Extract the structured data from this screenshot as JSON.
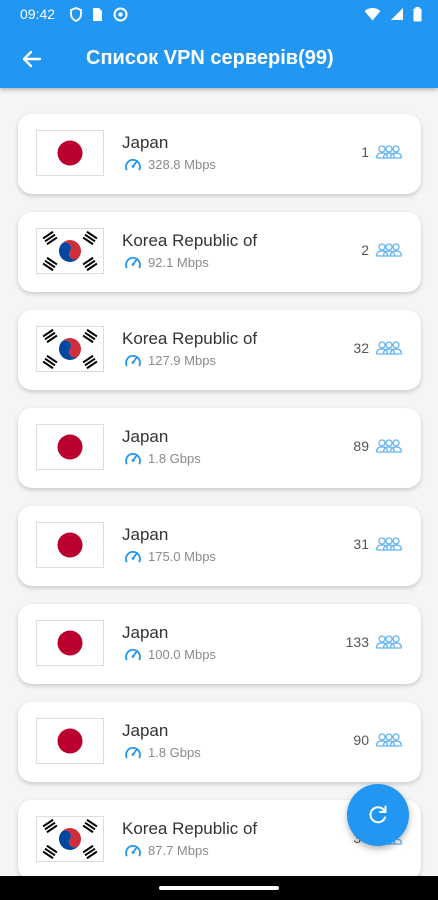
{
  "status_bar": {
    "time": "09:42",
    "left_icons": [
      "shield-icon",
      "sim-card-icon",
      "vpn-app-icon"
    ],
    "right_icons": [
      "wifi-icon",
      "signal-icon",
      "battery-icon"
    ]
  },
  "app_bar": {
    "back_icon": "arrow-back-icon",
    "title": "Список VPN серверів(99)"
  },
  "colors": {
    "primary": "#2196f3",
    "speed_icon": "#2196f3",
    "users_icon": "#64b5f6",
    "flag_japan_red": "#bc002d",
    "flag_korea_red": "#cd2e3a",
    "flag_korea_blue": "#0047a0"
  },
  "servers": [
    {
      "flag": "japan",
      "country": "Japan",
      "speed": "328.8 Mbps",
      "users": "1"
    },
    {
      "flag": "korea",
      "country": "Korea Republic of",
      "speed": "92.1 Mbps",
      "users": "2"
    },
    {
      "flag": "korea",
      "country": "Korea Republic of",
      "speed": "127.9 Mbps",
      "users": "32"
    },
    {
      "flag": "japan",
      "country": "Japan",
      "speed": "1.8 Gbps",
      "users": "89"
    },
    {
      "flag": "japan",
      "country": "Japan",
      "speed": "175.0 Mbps",
      "users": "31"
    },
    {
      "flag": "japan",
      "country": "Japan",
      "speed": "100.0 Mbps",
      "users": "133"
    },
    {
      "flag": "japan",
      "country": "Japan",
      "speed": "1.8 Gbps",
      "users": "90"
    },
    {
      "flag": "korea",
      "country": "Korea Republic of",
      "speed": "87.7 Mbps",
      "users": "37"
    }
  ],
  "fab": {
    "icon": "refresh-icon"
  }
}
